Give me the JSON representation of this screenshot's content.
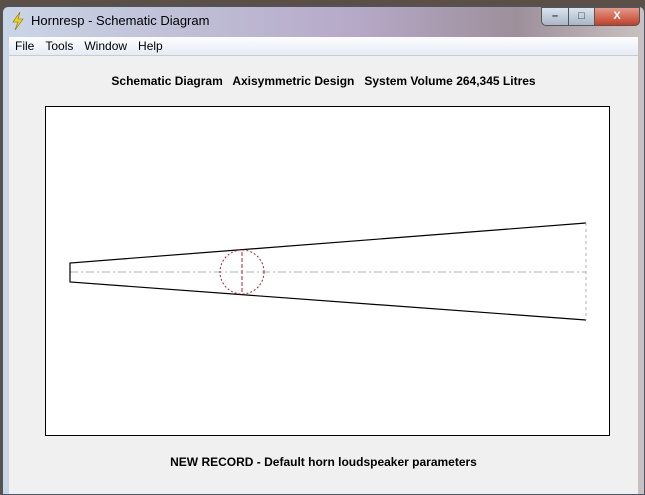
{
  "window": {
    "title": "Hornresp - Schematic Diagram",
    "minimize": "–",
    "maximize": "□",
    "close": "X"
  },
  "menu": [
    "File",
    "Tools",
    "Window",
    "Help"
  ],
  "heading": "Schematic Diagram   Axisymmetric Design   System Volume 264,345 Litres",
  "status": "NEW RECORD - Default horn loudspeaker parameters",
  "colors": {
    "outline": "#000000",
    "axis": "#b0b0b0",
    "driver": "#b02030"
  }
}
